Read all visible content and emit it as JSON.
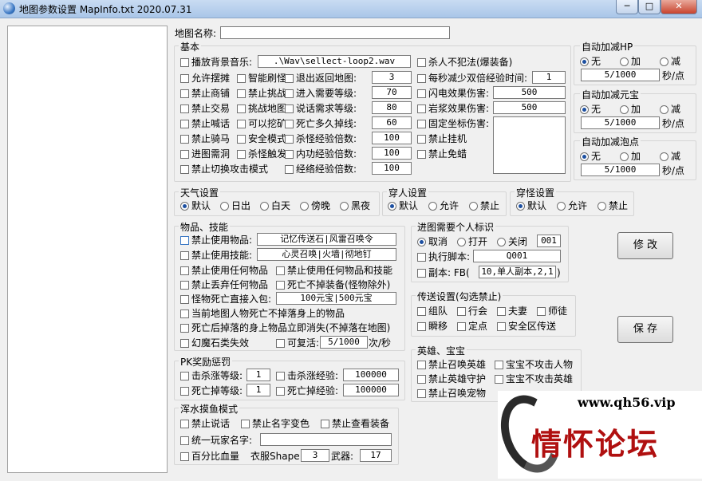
{
  "window": {
    "title": "地图参数设置 MapInfo.txt  2020.07.31",
    "min": "─",
    "max": "□",
    "close": "✕"
  },
  "mapname": {
    "label": "地图名称:",
    "value": ""
  },
  "basic": {
    "title": "基本",
    "music_label": "播放背景音乐:",
    "music_value": ".\\Wav\\sellect-loop2.wav",
    "c1": [
      "允许摆摊",
      "禁止商铺",
      "禁止交易",
      "禁止喊话",
      "禁止骑马",
      "进图需洞",
      "禁止切换攻击模式"
    ],
    "c2": [
      "智能刷怪",
      "禁止挑战",
      "挑战地图",
      "可以挖矿",
      "安全模式",
      "杀怪触发"
    ],
    "c3": [
      {
        "l": "退出返回地图:",
        "v": "3"
      },
      {
        "l": "进入需要等级:",
        "v": "70"
      },
      {
        "l": "说话需求等级:",
        "v": "80"
      },
      {
        "l": "死亡多久掉线:",
        "v": "60"
      },
      {
        "l": "杀怪经验倍数:",
        "v": "100"
      },
      {
        "l": "内功经验倍数:",
        "v": "100"
      },
      {
        "l": "经络经验倍数:",
        "v": "100"
      }
    ],
    "pk_immune": "杀人不犯法(爆装备)",
    "double_exp": {
      "l": "每秒减少双倍经验时间:",
      "v": "1"
    },
    "flash": {
      "l": "闪电效果伤害:",
      "v": "500"
    },
    "lava": {
      "l": "岩浆效果伤害:",
      "v": "500"
    },
    "fixed": "固定坐标伤害:",
    "hang": "禁止挂机",
    "fly": "禁止免蜡"
  },
  "hp": {
    "title": "自动加减HP",
    "opts": [
      "无",
      "加",
      "减"
    ],
    "value": "5/1000",
    "unit": "秒/点"
  },
  "yb": {
    "title": "自动加减元宝",
    "opts": [
      "无",
      "加",
      "减"
    ],
    "value": "5/1000",
    "unit": "秒/点"
  },
  "pd": {
    "title": "自动加减泡点",
    "opts": [
      "无",
      "加",
      "减"
    ],
    "value": "5/1000",
    "unit": "秒/点"
  },
  "weather": {
    "title": "天气设置",
    "opts": [
      "默认",
      "日出",
      "白天",
      "傍晚",
      "黑夜"
    ]
  },
  "wear": {
    "title": "穿人设置",
    "opts": [
      "默认",
      "允许",
      "禁止"
    ]
  },
  "wearm": {
    "title": "穿怪设置",
    "opts": [
      "默认",
      "允许",
      "禁止"
    ]
  },
  "items": {
    "title": "物品、技能",
    "r1": {
      "l": "禁止使用物品:",
      "v": "记忆传送石|风雷召唤令"
    },
    "r2": {
      "l": "禁止使用技能:",
      "v": "心灵召唤|火墙|彻地钉"
    },
    "r3a": "禁止使用任何物品",
    "r3b": "禁止使用任何物品和技能",
    "r4a": "禁止丢弃任何物品",
    "r4b": "死亡不掉装备(怪物除外)",
    "r5": {
      "l": "怪物死亡直接入包:",
      "v": "100元宝|500元宝"
    },
    "r6": "当前地图人物死亡不掉落身上的物品",
    "r7": "死亡后掉落的身上物品立即消失(不掉落在地图)",
    "r8a": "幻魔石类失效",
    "r8b": "可复活:",
    "r8v": "5/1000",
    "r8u": "次/秒"
  },
  "pk": {
    "title": "PK奖励惩罚",
    "a": {
      "l": "击杀涨等级:",
      "v": "1"
    },
    "b": {
      "l": "击杀涨经验:",
      "v": "100000"
    },
    "c": {
      "l": "死亡掉等级:",
      "v": "1"
    },
    "d": {
      "l": "死亡掉经验:",
      "v": "100000"
    }
  },
  "fish": {
    "title": "浑水摸鱼模式",
    "a": "禁止说话",
    "b": "禁止名字变色",
    "c": "禁止查看装备",
    "d": "统一玩家名字:",
    "dv": "",
    "e": "百分比血量",
    "shape_l": "衣服Shape:",
    "shape_v": "3",
    "weap_l": "武器:",
    "weap_v": "17"
  },
  "mark": {
    "title": "进图需要个人标识",
    "opts": [
      "取消",
      "打开",
      "关闭"
    ],
    "val": "001",
    "script_l": "执行脚本:",
    "script_v": "Q001",
    "fb_l": "副本: FB(",
    "fb_v": "10,单人副本,2,1",
    ")": ")"
  },
  "tele": {
    "title": "传送设置(勾选禁止)",
    "a": "组队",
    "b": "行会",
    "c": "夫妻",
    "d": "师徒",
    "e": "瞬移",
    "f": "定点",
    "g": "安全区传送"
  },
  "hero": {
    "title": "英雄、宝宝",
    "a": "禁止召唤英雄",
    "b": "宝宝不攻击人物",
    "c": "禁止英雄守护",
    "d": "宝宝不攻击英雄",
    "e": "禁止召唤宠物"
  },
  "buttons": {
    "modify": "修 改",
    "save": "保 存"
  },
  "watermark": {
    "url": "www.qh56.vip",
    "text": "情怀论坛"
  }
}
